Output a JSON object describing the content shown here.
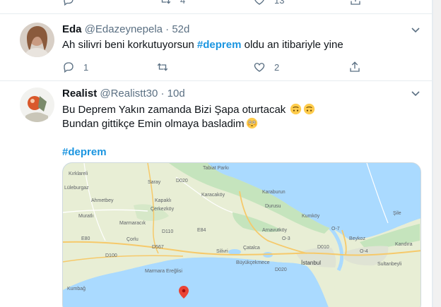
{
  "top_actions": {
    "retweet_count": "4",
    "like_count": "13"
  },
  "tweets": [
    {
      "name": "Eda",
      "handle": "@Edazeynepela",
      "separator": "·",
      "time": "52d",
      "text_before": "Ah silivri beni korkutuyorsun ",
      "hashtag": "#deprem",
      "text_after": " oldu an itibariyle yine",
      "reply_count": "1",
      "retweet_count": "",
      "like_count": "2"
    },
    {
      "name": "Realist",
      "handle": "@Realistt30",
      "separator": "·",
      "time": "10d",
      "line1": "Bu Deprem Yakın zamanda Bizi  Şapa oturtacak ",
      "line2": "Bundan gittikçe Emin olmaya basladim",
      "hashtag": "#deprem",
      "emoji_1": "upside-down-face",
      "emoji_2": "flushed-face"
    }
  ],
  "map": {
    "labels": {
      "tabiat_parki": "Tabiat Parkı",
      "saray": "Saray",
      "kirklareli": "Kırklareli",
      "luleburgaz": "Lüleburgaz",
      "ahmetbey": "Ahmetbey",
      "kapakli": "Kapaklı",
      "cerkezkoy": "Çerkezköy",
      "muratli": "Muratlı",
      "marmaracik": "Marmaracık",
      "corlu": "Çorlu",
      "silivri": "Silivri",
      "marmara_ereglisi": "Marmara Ereğlisi",
      "karacakoy": "Karacaköy",
      "durusu": "Durusu",
      "arnavutkoy": "Arnavutköy",
      "catalca": "Çatalca",
      "buyukcekmece": "Büyükçekmece",
      "istanbul": "İstanbul",
      "sultanbeyli": "Sultanbeyli",
      "kumbag": "Kumbağ",
      "karaburun": "Karaburun",
      "kumkoy": "Kumköy",
      "sile": "Şile",
      "beykoz": "Beykoz",
      "kandira": "Kandıra",
      "road_e80": "E80",
      "road_o3": "O-3",
      "road_o4": "O-4",
      "road_d110": "D110",
      "road_d020": "D020",
      "road_d100": "D100",
      "road_d567": "D567",
      "road_e84": "E84",
      "road_d010": "D010",
      "road_o7": "O-7",
      "road_d020b": "D020"
    },
    "sea_color": "#aadaff",
    "land_color": "#e8eed5",
    "forest_color": "#c5e4bd",
    "pin_color": "#ea4335"
  }
}
